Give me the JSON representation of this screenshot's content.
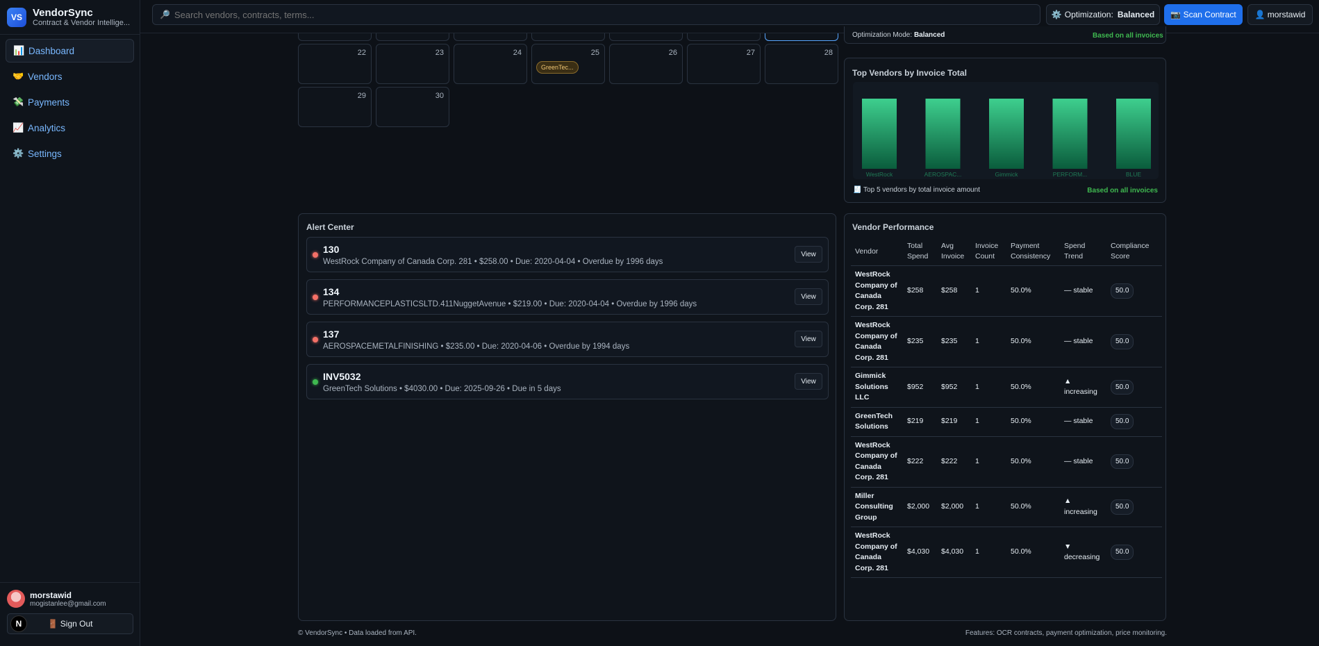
{
  "app": {
    "logo": "VS",
    "title": "VendorSync",
    "subtitle": "Contract & Vendor Intellige..."
  },
  "nav": [
    {
      "icon": "📊",
      "label": "Dashboard",
      "active": true
    },
    {
      "icon": "🤝",
      "label": "Vendors"
    },
    {
      "icon": "💸",
      "label": "Payments"
    },
    {
      "icon": "📈",
      "label": "Analytics"
    },
    {
      "icon": "⚙️",
      "label": "Settings"
    }
  ],
  "user": {
    "name": "morstawid",
    "email": "mogistanlee@gmail.com",
    "signout": "🚪 Sign Out",
    "badge": "N"
  },
  "topbar": {
    "search_placeholder": "Search vendors, contracts, terms...",
    "search_icon": "🔎",
    "optimization_label": "Optimization:",
    "optimization_value": "Balanced",
    "scan_label": "📷 Scan Contract",
    "user_label": "👤 morstawid"
  },
  "calendar": {
    "row1": [
      "22",
      "23",
      "24",
      "25",
      "26",
      "27",
      "28"
    ],
    "row2": [
      "29",
      "30"
    ],
    "event_chip": "GreenTec..."
  },
  "optimization_panel": {
    "mode_label": "Optimization Mode:",
    "mode_value": "Balanced",
    "note": "Based on all invoices"
  },
  "top_vendors": {
    "title": "Top Vendors by Invoice Total",
    "caption": "🧾 Top 5 vendors by total invoice amount",
    "note": "Based on all invoices"
  },
  "chart_data": {
    "type": "bar",
    "title": "Top Vendors by Invoice Total",
    "categories": [
      "WestRock",
      "AEROSPAC...",
      "Gimmick",
      "PERFORM...",
      "BLUE"
    ],
    "values": [
      100,
      100,
      100,
      100,
      100
    ],
    "ylim": [
      0,
      100
    ],
    "grid": false,
    "color": "#1f9d6a"
  },
  "alerts": {
    "title": "Alert Center",
    "view_label": "View",
    "items": [
      {
        "id": "130",
        "status": "red",
        "desc": "WestRock Company of Canada Corp. 281 • $258.00 • Due: 2020-04-04 • Overdue by 1996 days"
      },
      {
        "id": "134",
        "status": "red",
        "desc": "PERFORMANCEPLASTICSLTD.411NuggetAvenue • $219.00 • Due: 2020-04-04 • Overdue by 1996 days"
      },
      {
        "id": "137",
        "status": "red",
        "desc": "AEROSPACEMETALFINISHING • $235.00 • Due: 2020-04-06 • Overdue by 1994 days"
      },
      {
        "id": "INV5032",
        "status": "green",
        "desc": "GreenTech Solutions • $4030.00 • Due: 2025-09-26 • Due in 5 days"
      }
    ]
  },
  "vendor_performance": {
    "title": "Vendor Performance",
    "columns": [
      "Vendor",
      "Total Spend",
      "Avg Invoice",
      "Invoice Count",
      "Payment Consistency",
      "Spend Trend",
      "Compliance Score"
    ],
    "rows": [
      {
        "vendor": "WestRock Company of Canada Corp. 281",
        "total": "$258",
        "avg": "$258",
        "count": "1",
        "consistency": "50.0%",
        "trend": "— stable",
        "trend_type": "stable",
        "score": "50.0"
      },
      {
        "vendor": "WestRock Company of Canada Corp. 281",
        "total": "$235",
        "avg": "$235",
        "count": "1",
        "consistency": "50.0%",
        "trend": "— stable",
        "trend_type": "stable",
        "score": "50.0"
      },
      {
        "vendor": "Gimmick Solutions LLC",
        "total": "$952",
        "avg": "$952",
        "count": "1",
        "consistency": "50.0%",
        "trend": "▲ increasing",
        "trend_type": "up",
        "score": "50.0"
      },
      {
        "vendor": "GreenTech Solutions",
        "total": "$219",
        "avg": "$219",
        "count": "1",
        "consistency": "50.0%",
        "trend": "— stable",
        "trend_type": "stable",
        "score": "50.0"
      },
      {
        "vendor": "WestRock Company of Canada Corp. 281",
        "total": "$222",
        "avg": "$222",
        "count": "1",
        "consistency": "50.0%",
        "trend": "— stable",
        "trend_type": "stable",
        "score": "50.0"
      },
      {
        "vendor": "Miller Consulting Group",
        "total": "$2,000",
        "avg": "$2,000",
        "count": "1",
        "consistency": "50.0%",
        "trend": "▲ increasing",
        "trend_type": "up",
        "score": "50.0"
      },
      {
        "vendor": "WestRock Company of Canada Corp. 281",
        "total": "$4,030",
        "avg": "$4,030",
        "count": "1",
        "consistency": "50.0%",
        "trend": "▼ decreasing",
        "trend_type": "down",
        "score": "50.0"
      }
    ]
  },
  "footer": {
    "left": "© VendorSync • Data loaded from API.",
    "right": "Features: OCR contracts, payment optimization, price monitoring."
  }
}
